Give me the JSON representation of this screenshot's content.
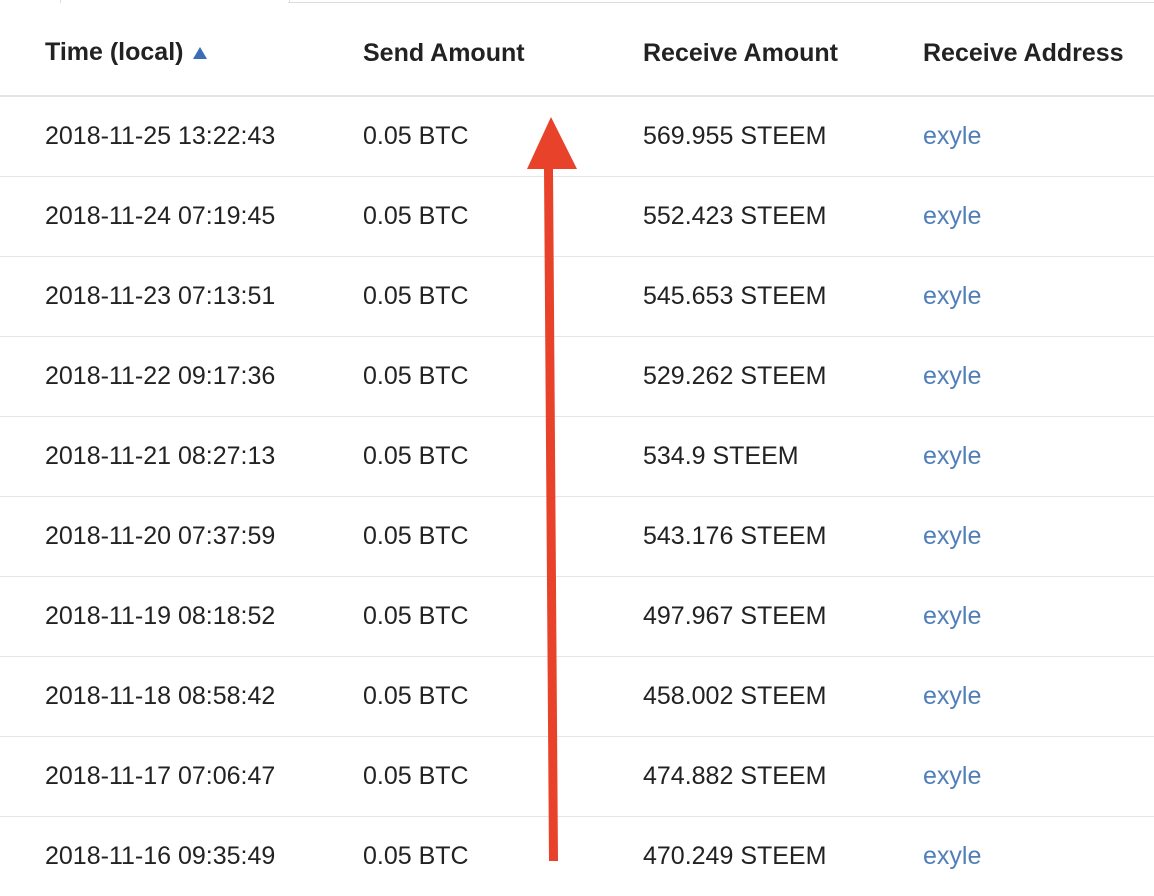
{
  "table": {
    "columns": [
      {
        "label": "Time (local)",
        "sorted": "ascending"
      },
      {
        "label": "Send Amount"
      },
      {
        "label": "Receive Amount"
      },
      {
        "label": "Receive Address"
      }
    ],
    "rows": [
      {
        "time": "2018-11-25 13:22:43",
        "send": "0.05 BTC",
        "receive": "569.955 STEEM",
        "address": "exyle"
      },
      {
        "time": "2018-11-24 07:19:45",
        "send": "0.05 BTC",
        "receive": "552.423 STEEM",
        "address": "exyle"
      },
      {
        "time": "2018-11-23 07:13:51",
        "send": "0.05 BTC",
        "receive": "545.653 STEEM",
        "address": "exyle"
      },
      {
        "time": "2018-11-22 09:17:36",
        "send": "0.05 BTC",
        "receive": "529.262 STEEM",
        "address": "exyle"
      },
      {
        "time": "2018-11-21 08:27:13",
        "send": "0.05 BTC",
        "receive": "534.9 STEEM",
        "address": "exyle"
      },
      {
        "time": "2018-11-20 07:37:59",
        "send": "0.05 BTC",
        "receive": "543.176 STEEM",
        "address": "exyle"
      },
      {
        "time": "2018-11-19 08:18:52",
        "send": "0.05 BTC",
        "receive": "497.967 STEEM",
        "address": "exyle"
      },
      {
        "time": "2018-11-18 08:58:42",
        "send": "0.05 BTC",
        "receive": "458.002 STEEM",
        "address": "exyle"
      },
      {
        "time": "2018-11-17 07:06:47",
        "send": "0.05 BTC",
        "receive": "474.882 STEEM",
        "address": "exyle"
      },
      {
        "time": "2018-11-16 09:35:49",
        "send": "0.05 BTC",
        "receive": "470.249 STEEM",
        "address": "exyle"
      }
    ]
  },
  "icons": {
    "sort": "sort-ascending-icon",
    "annotation": "red-up-arrow"
  },
  "colors": {
    "link": "#4f7fb8",
    "sort_icon": "#3a6db6",
    "annotation_arrow": "#e8432a",
    "row_divider": "#e6e6e6"
  }
}
